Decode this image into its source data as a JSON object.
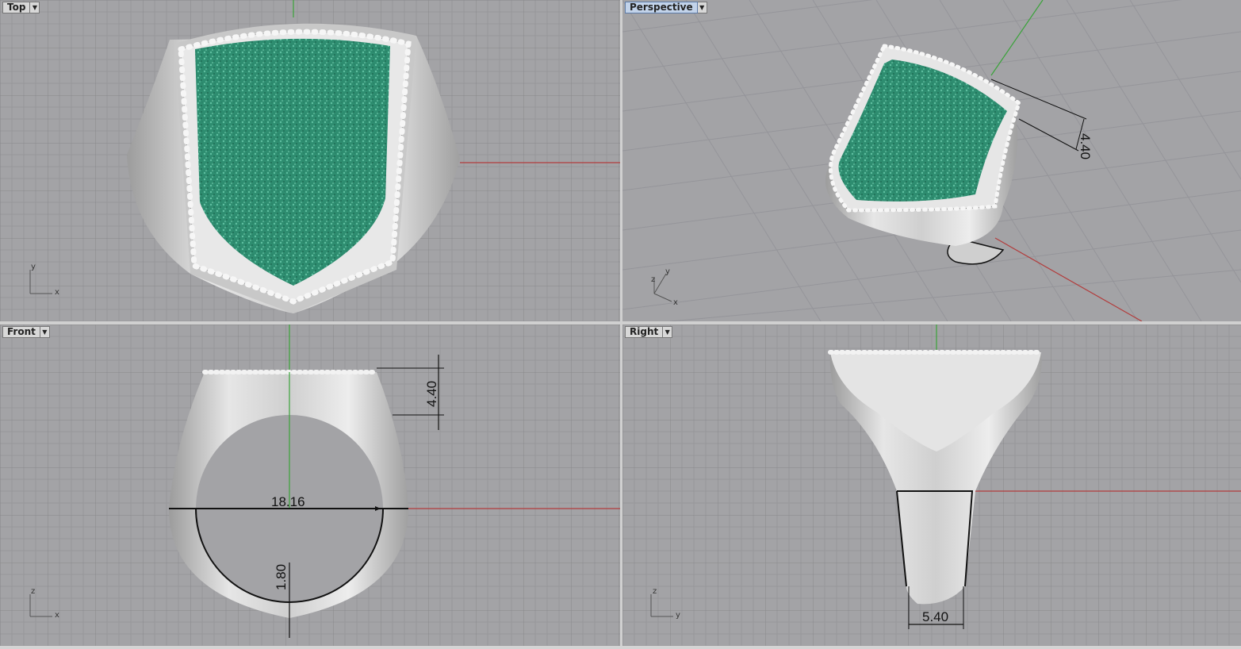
{
  "viewports": {
    "top": {
      "label": "Top",
      "axis_labels": [
        "y",
        "x"
      ]
    },
    "perspective": {
      "label": "Perspective",
      "axis_labels": [
        "z",
        "y",
        "x"
      ],
      "dimension": "4.40"
    },
    "front": {
      "label": "Front",
      "axis_labels": [
        "z",
        "x"
      ],
      "dim_height": "4.40",
      "dim_diameter": "18.16",
      "dim_thickness": "1.80"
    },
    "right": {
      "label": "Right",
      "axis_labels": [
        "z",
        "y"
      ],
      "dim_width": "5.40"
    }
  },
  "dropdown_icon": "chevron-down-icon",
  "colors": {
    "viewport_bg": "#a3a3a6",
    "grid_minor": "#979799",
    "grid_major": "#8a8a8d",
    "axis_x": "#b23c3c",
    "axis_y": "#3aa33a",
    "metal": "#d4d4d4",
    "gem": "#2f8f73",
    "active_label": "#c2d3ea"
  }
}
